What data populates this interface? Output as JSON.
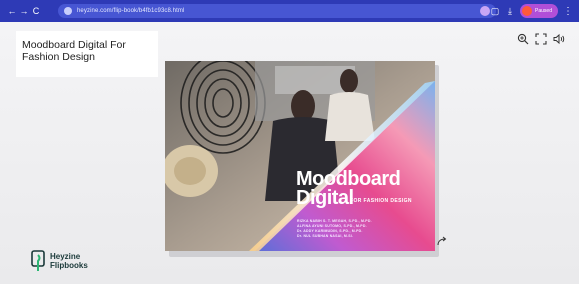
{
  "browser": {
    "nav": {
      "back": "←",
      "forward": "→",
      "reload": "C"
    },
    "url": "heyzine.com/flip-book/b4fb1c93c8.html",
    "profile_label": "Paused"
  },
  "book": {
    "title": "Moodboard Digital For Fashion Design"
  },
  "toolbar": {
    "zoom": "zoom-in-icon",
    "fullscreen": "fullscreen-icon",
    "sound": "sound-icon"
  },
  "cover": {
    "title_line1": "Moodboard",
    "title_line2": "Digital",
    "subtitle": "FOR FASHION DESIGN",
    "authors": [
      "RIZKA NABIH S. T. MEGAH, S.PD., M.PD.",
      "ALFINA AYUNI SUTOMO, S.PD., M.PD.",
      "Dr. ADDY KARIMUDIN, S.PD., M.PD.",
      "Dr. NUL SUBHAN NASAI, M.SI."
    ]
  },
  "brand": {
    "name_line1": "Heyzine",
    "name_line2": "Flipbooks"
  },
  "colors": {
    "browser_bar": "#2e3ab6",
    "address_bar": "#4756d3",
    "cover_pink": "#e0488e",
    "cover_purple": "#8a4fd0"
  }
}
